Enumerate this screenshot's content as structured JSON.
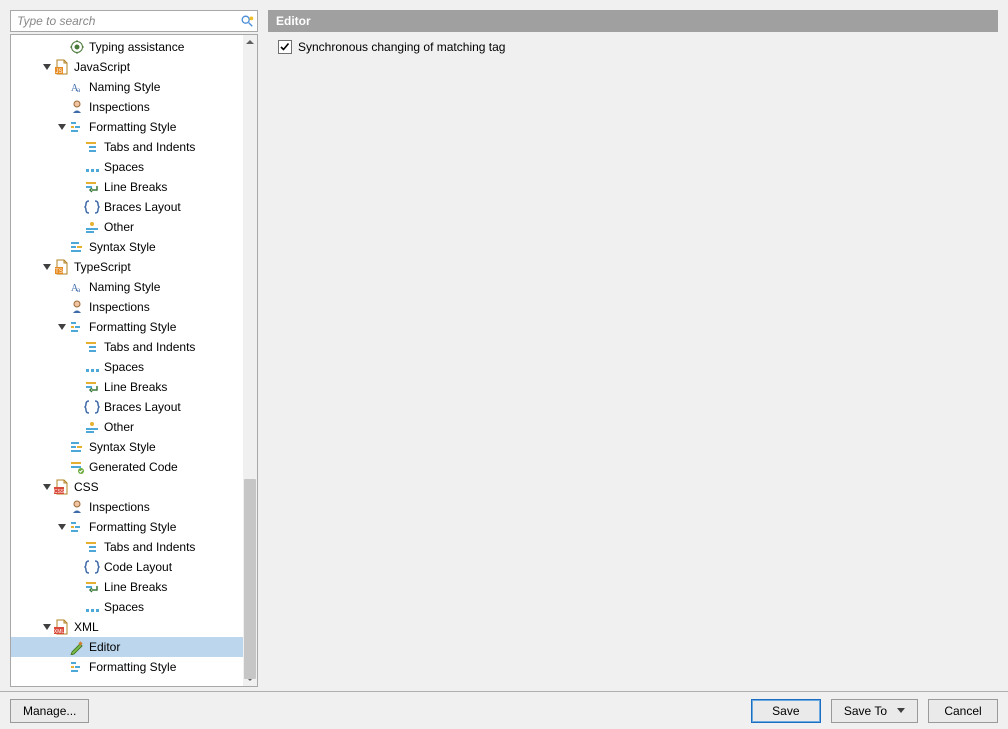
{
  "search": {
    "placeholder": "Type to search"
  },
  "header": {
    "title": "Editor"
  },
  "option": {
    "label": "Synchronous changing of matching tag",
    "checked": true
  },
  "buttons": {
    "manage": "Manage...",
    "save": "Save",
    "save_to": "Save To",
    "cancel": "Cancel"
  },
  "tree": [
    {
      "id": "typing-assist",
      "label": "Typing assistance",
      "icon": "assist",
      "indent": 3,
      "toggle": "none"
    },
    {
      "id": "javascript",
      "label": "JavaScript",
      "icon": "jsfile",
      "indent": 2,
      "toggle": "open"
    },
    {
      "id": "js-naming",
      "label": "Naming Style",
      "icon": "naming",
      "indent": 3,
      "toggle": "none"
    },
    {
      "id": "js-inspections",
      "label": "Inspections",
      "icon": "inspections",
      "indent": 3,
      "toggle": "none"
    },
    {
      "id": "js-formatting",
      "label": "Formatting Style",
      "icon": "formatting",
      "indent": 3,
      "toggle": "open"
    },
    {
      "id": "js-tabs",
      "label": "Tabs and Indents",
      "icon": "tabs",
      "indent": 4,
      "toggle": "none"
    },
    {
      "id": "js-spaces",
      "label": "Spaces",
      "icon": "spaces",
      "indent": 4,
      "toggle": "none"
    },
    {
      "id": "js-linebreaks",
      "label": "Line Breaks",
      "icon": "linebreaks",
      "indent": 4,
      "toggle": "none"
    },
    {
      "id": "js-braces",
      "label": "Braces Layout",
      "icon": "braces",
      "indent": 4,
      "toggle": "none"
    },
    {
      "id": "js-other",
      "label": "Other",
      "icon": "other",
      "indent": 4,
      "toggle": "none"
    },
    {
      "id": "js-syntax",
      "label": "Syntax Style",
      "icon": "syntax",
      "indent": 3,
      "toggle": "none"
    },
    {
      "id": "typescript",
      "label": "TypeScript",
      "icon": "tsfile",
      "indent": 2,
      "toggle": "open"
    },
    {
      "id": "ts-naming",
      "label": "Naming Style",
      "icon": "naming",
      "indent": 3,
      "toggle": "none"
    },
    {
      "id": "ts-inspections",
      "label": "Inspections",
      "icon": "inspections",
      "indent": 3,
      "toggle": "none"
    },
    {
      "id": "ts-formatting",
      "label": "Formatting Style",
      "icon": "formatting",
      "indent": 3,
      "toggle": "open"
    },
    {
      "id": "ts-tabs",
      "label": "Tabs and Indents",
      "icon": "tabs",
      "indent": 4,
      "toggle": "none"
    },
    {
      "id": "ts-spaces",
      "label": "Spaces",
      "icon": "spaces",
      "indent": 4,
      "toggle": "none"
    },
    {
      "id": "ts-linebreaks",
      "label": "Line Breaks",
      "icon": "linebreaks",
      "indent": 4,
      "toggle": "none"
    },
    {
      "id": "ts-braces",
      "label": "Braces Layout",
      "icon": "braces",
      "indent": 4,
      "toggle": "none"
    },
    {
      "id": "ts-other",
      "label": "Other",
      "icon": "other",
      "indent": 4,
      "toggle": "none"
    },
    {
      "id": "ts-syntax",
      "label": "Syntax Style",
      "icon": "syntax",
      "indent": 3,
      "toggle": "none"
    },
    {
      "id": "ts-generated",
      "label": "Generated Code",
      "icon": "generated",
      "indent": 3,
      "toggle": "none"
    },
    {
      "id": "css",
      "label": "CSS",
      "icon": "cssfile",
      "indent": 2,
      "toggle": "open"
    },
    {
      "id": "css-inspections",
      "label": "Inspections",
      "icon": "inspections",
      "indent": 3,
      "toggle": "none"
    },
    {
      "id": "css-formatting",
      "label": "Formatting Style",
      "icon": "formatting",
      "indent": 3,
      "toggle": "open"
    },
    {
      "id": "css-tabs",
      "label": "Tabs and Indents",
      "icon": "tabs",
      "indent": 4,
      "toggle": "none"
    },
    {
      "id": "css-codelayout",
      "label": "Code Layout",
      "icon": "braces",
      "indent": 4,
      "toggle": "none"
    },
    {
      "id": "css-linebreaks",
      "label": "Line Breaks",
      "icon": "linebreaks",
      "indent": 4,
      "toggle": "none"
    },
    {
      "id": "css-spaces",
      "label": "Spaces",
      "icon": "spaces",
      "indent": 4,
      "toggle": "none"
    },
    {
      "id": "xml",
      "label": "XML",
      "icon": "xmlfile",
      "indent": 2,
      "toggle": "open"
    },
    {
      "id": "xml-editor",
      "label": "Editor",
      "icon": "editor",
      "indent": 3,
      "toggle": "none",
      "selected": true
    },
    {
      "id": "xml-formatting",
      "label": "Formatting Style",
      "icon": "formatting",
      "indent": 3,
      "toggle": "none"
    }
  ]
}
